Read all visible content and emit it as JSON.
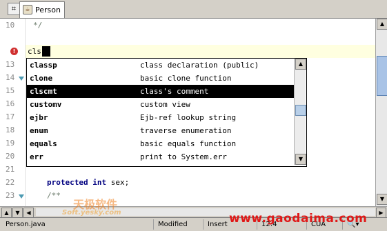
{
  "tab": {
    "title": "Person"
  },
  "gutter": {
    "line_numbers": [
      "10",
      "",
      "",
      "13",
      "14",
      "15",
      "16",
      "17",
      "18",
      "19",
      "20",
      "21",
      "22",
      "23"
    ]
  },
  "code": {
    "line10": "*/",
    "typed": "cls",
    "line22": {
      "kw1": "protected",
      "kw2": "int",
      "rest": " sex;"
    },
    "line23": "/**"
  },
  "completion": {
    "items": [
      {
        "name": "classp",
        "desc": "class declaration (public)"
      },
      {
        "name": "clone",
        "desc": "basic clone function"
      },
      {
        "name": "clscmt",
        "desc": "class's comment"
      },
      {
        "name": "customv",
        "desc": "custom view"
      },
      {
        "name": "ejbr",
        "desc": "Ejb-ref lookup string"
      },
      {
        "name": "enum",
        "desc": "traverse enumeration"
      },
      {
        "name": "equals",
        "desc": "basic equals function"
      },
      {
        "name": "err",
        "desc": "print to System.err"
      }
    ],
    "selected_index": 2
  },
  "status": {
    "file": "Person.java",
    "modified": "Modified",
    "mode": "Insert",
    "position": "12:4",
    "encoding": "CUA"
  },
  "watermarks": {
    "logo_cn": "天极软件",
    "logo_url": "Soft.yesky.com",
    "site": "www.gaodaima.com"
  },
  "colors": {
    "selection": "#000000",
    "current_line": "#ffffe0",
    "keyword": "#000080",
    "error": "#d03030"
  }
}
